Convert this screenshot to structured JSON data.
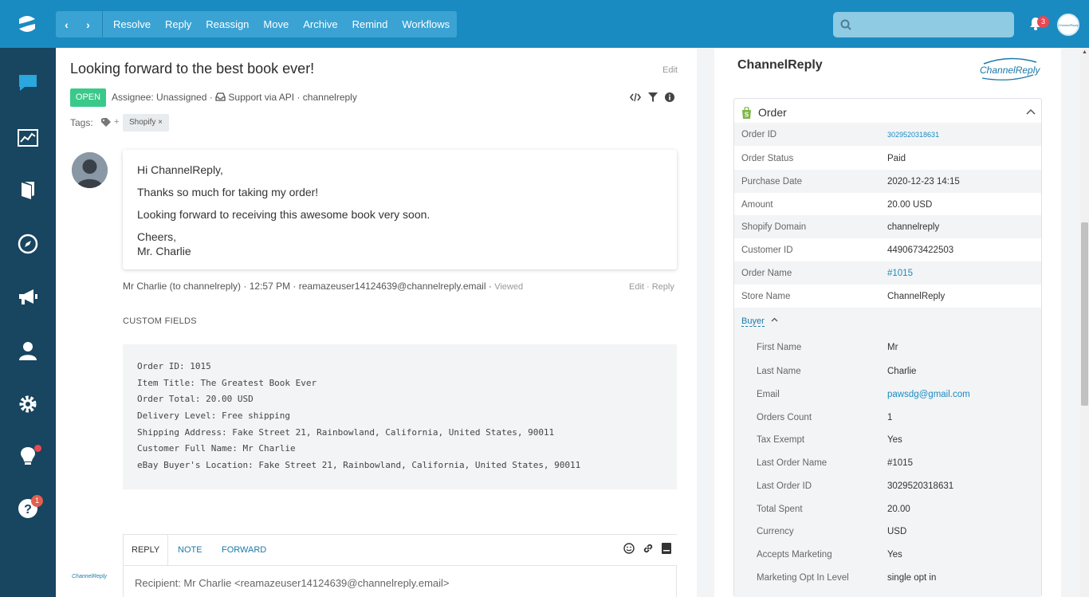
{
  "topbar": {
    "nav_back": "‹",
    "nav_forward": "›",
    "actions": [
      "Resolve",
      "Reply",
      "Reassign",
      "Move",
      "Archive",
      "Remind",
      "Workflows"
    ],
    "notification_count": "3",
    "avatar_text": "ChannelReply"
  },
  "rail": {
    "help_badge": "1"
  },
  "conversation": {
    "title": "Looking forward to the best book ever!",
    "edit_label": "Edit",
    "status": "OPEN",
    "assignee": "Assignee: Unassigned · ",
    "channel": "Support via API · channelreply",
    "tags_label": "Tags:",
    "tag_add": "+",
    "tag": "Shopify ×"
  },
  "message": {
    "greeting": "Hi ChannelReply,",
    "line1": "Thanks so much for taking my order!",
    "line2": "Looking forward to receiving this awesome book very soon.",
    "closing": "Cheers,",
    "signature": "Mr. Charlie",
    "footer": "Mr Charlie (to channelreply) · 12:57 PM · reamazeuser14124639@channelreply.email · ",
    "viewed": "Viewed",
    "actions": "Edit · Reply"
  },
  "custom_fields": {
    "label": "CUSTOM FIELDS",
    "lines": [
      "Order ID: 1015",
      "Item Title: The Greatest Book Ever",
      "Order Total: 20.00 USD",
      "Delivery Level: Free shipping",
      "Shipping Address: Fake Street 21, Rainbowland, California, United States, 90011",
      "Customer Full Name: Mr Charlie",
      "eBay Buyer's Location: Fake Street 21, Rainbowland, California, United States, 90011"
    ]
  },
  "reply": {
    "tabs": [
      "REPLY",
      "NOTE",
      "FORWARD"
    ],
    "recipient": "Recipient: Mr Charlie <reamazeuser14124639@channelreply.email>",
    "logo_text": "ChannelReply"
  },
  "sidebar": {
    "title": "ChannelReply",
    "logo_text": "ChannelReply",
    "order_label": "Order",
    "order_fields": [
      {
        "k": "Order ID",
        "v": "3029520318631"
      },
      {
        "k": "Order Status",
        "v": "Paid"
      },
      {
        "k": "Purchase Date",
        "v": "2020-12-23 14:15"
      },
      {
        "k": "Amount",
        "v": "20.00 USD"
      },
      {
        "k": "Shopify Domain",
        "v": "channelreply"
      },
      {
        "k": "Customer ID",
        "v": "4490673422503"
      },
      {
        "k": "Order Name",
        "v": "#1015"
      },
      {
        "k": "Store Name",
        "v": "ChannelReply"
      }
    ],
    "buyer_label": "Buyer",
    "buyer_fields": [
      {
        "k": "First Name",
        "v": "Mr"
      },
      {
        "k": "Last Name",
        "v": "Charlie"
      },
      {
        "k": "Email",
        "v": "pawsdg@gmail.com"
      },
      {
        "k": "Orders Count",
        "v": "1"
      },
      {
        "k": "Tax Exempt",
        "v": "Yes"
      },
      {
        "k": "Last Order Name",
        "v": "#1015"
      },
      {
        "k": "Last Order ID",
        "v": "3029520318631"
      },
      {
        "k": "Total Spent",
        "v": "20.00"
      },
      {
        "k": "Currency",
        "v": "USD"
      },
      {
        "k": "Accepts Marketing",
        "v": "Yes"
      },
      {
        "k": "Marketing Opt In Level",
        "v": "single opt in"
      }
    ]
  },
  "colors": {
    "topbar": "#1a8bc0",
    "rail": "#18455f",
    "open": "#3ac98a",
    "link": "#1a8bc0"
  }
}
